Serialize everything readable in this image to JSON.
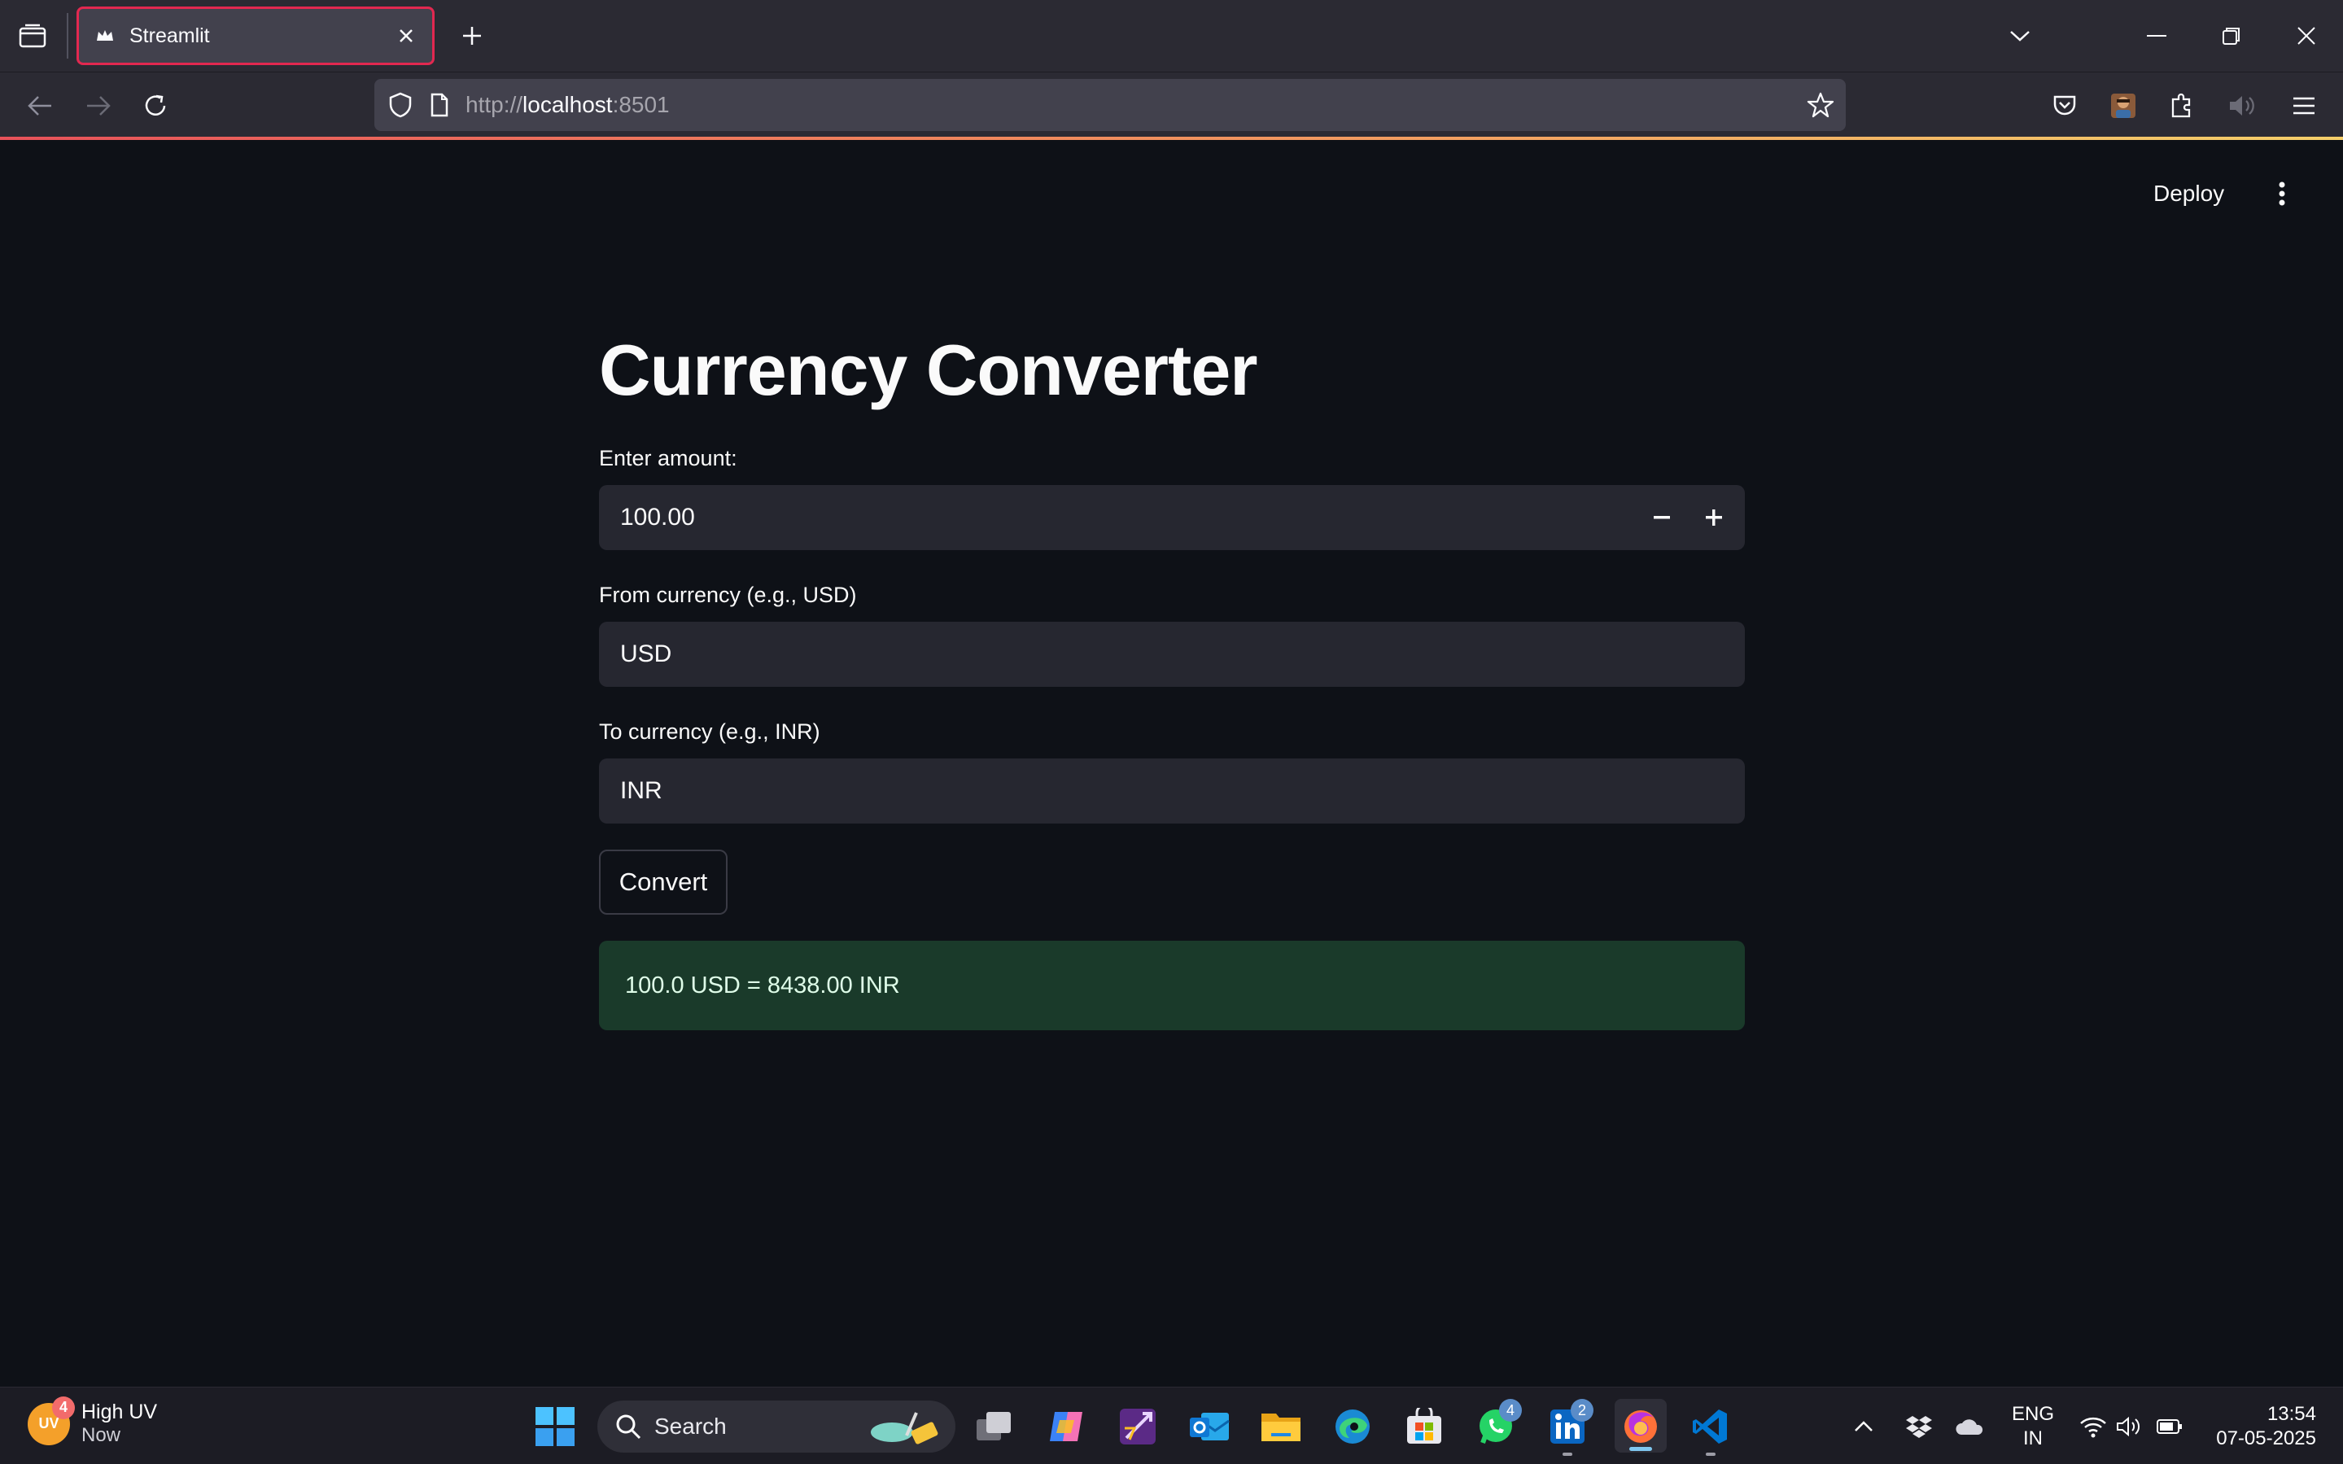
{
  "browser": {
    "tab_title": "Streamlit",
    "url_scheme": "http://",
    "url_host": "localhost",
    "url_port": ":8501"
  },
  "app": {
    "header": {
      "deploy_label": "Deploy"
    },
    "title": "Currency Converter",
    "amount": {
      "label": "Enter amount:",
      "value": "100.00"
    },
    "from_currency": {
      "label": "From currency (e.g., USD)",
      "value": "USD"
    },
    "to_currency": {
      "label": "To currency (e.g., INR)",
      "value": "INR"
    },
    "convert_label": "Convert",
    "result": "100.0 USD = 8438.00 INR"
  },
  "taskbar": {
    "weather": {
      "badge": "4",
      "icon_text": "UV",
      "title": "High UV",
      "subtitle": "Now"
    },
    "search_label": "Search",
    "apps": [
      {
        "name": "task-view-icon"
      },
      {
        "name": "copilot-icon"
      },
      {
        "name": "visual-studio-icon"
      },
      {
        "name": "outlook-icon"
      },
      {
        "name": "file-explorer-icon"
      },
      {
        "name": "edge-icon"
      },
      {
        "name": "microsoft-store-icon"
      },
      {
        "name": "whatsapp-icon",
        "badge": "4"
      },
      {
        "name": "linkedin-icon",
        "badge": "2"
      },
      {
        "name": "firefox-icon"
      },
      {
        "name": "vscode-icon"
      }
    ],
    "language": {
      "line1": "ENG",
      "line2": "IN"
    },
    "time": "13:54",
    "date": "07-05-2025"
  },
  "colors": {
    "page_bg": "#0e1117",
    "input_bg": "#262730",
    "success_bg": "#1a3a2a",
    "tab_highlight": "#e22850"
  }
}
